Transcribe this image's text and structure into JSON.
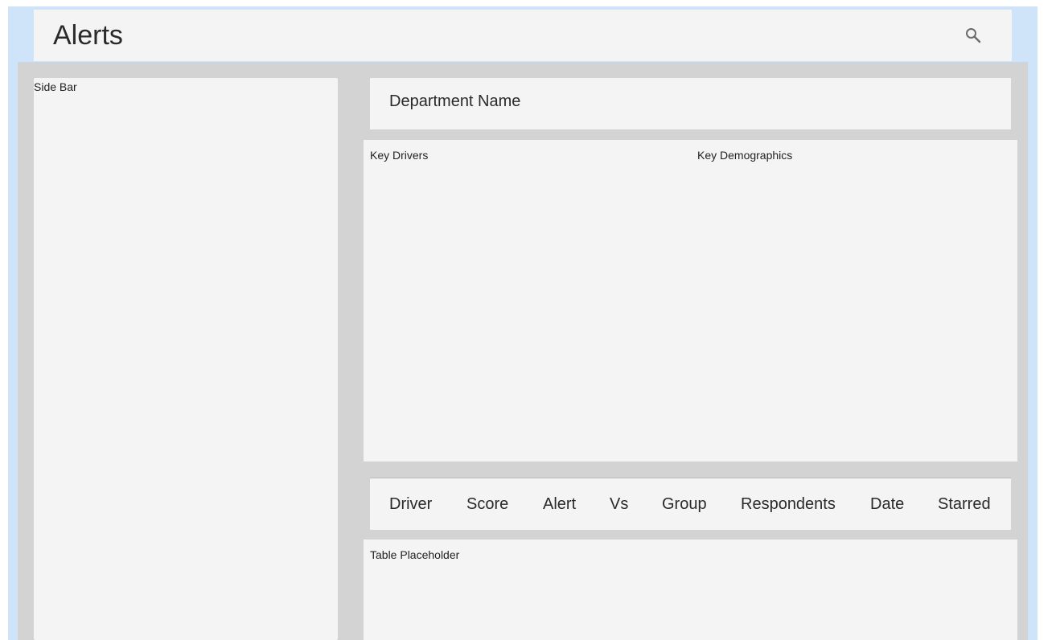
{
  "header": {
    "title": "Alerts",
    "search_icon": "search-icon"
  },
  "sidebar": {
    "label": "Side Bar"
  },
  "department": {
    "name": "Department Name"
  },
  "panels": {
    "key_drivers": "Key Drivers",
    "key_demographics": "Key Demographics"
  },
  "table": {
    "columns": [
      "Driver",
      "Score",
      "Alert",
      "Vs",
      "Group",
      "Respondents",
      "Date",
      "Starred"
    ],
    "placeholder": "Table Placeholder"
  },
  "colors": {
    "frame_background": "#cfe4f8",
    "content_background": "#d3d3d3",
    "panel_background": "#f4f4f4",
    "text": "#222222"
  }
}
